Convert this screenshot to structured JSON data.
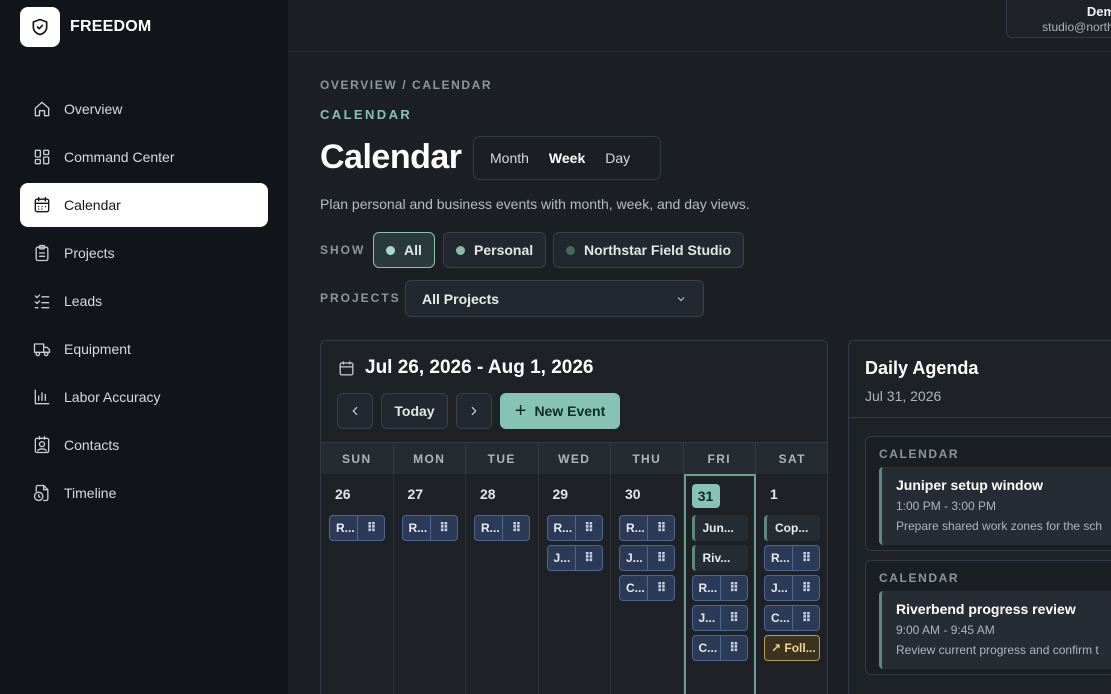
{
  "app": {
    "name": "FREEDOM"
  },
  "user": {
    "name": "Demo",
    "email": "studio@northst"
  },
  "sidebar": {
    "items": [
      {
        "label": "Overview",
        "icon": "home-icon"
      },
      {
        "label": "Command Center",
        "icon": "grid-icon"
      },
      {
        "label": "Calendar",
        "icon": "calendar-icon",
        "active": true
      },
      {
        "label": "Projects",
        "icon": "clipboard-icon"
      },
      {
        "label": "Leads",
        "icon": "checklist-icon"
      },
      {
        "label": "Equipment",
        "icon": "truck-icon"
      },
      {
        "label": "Labor Accuracy",
        "icon": "bar-chart-icon"
      },
      {
        "label": "Contacts",
        "icon": "contact-card-icon"
      },
      {
        "label": "Timeline",
        "icon": "clock-file-icon"
      }
    ]
  },
  "header": {
    "breadcrumb": "OVERVIEW / CALENDAR",
    "section": "CALENDAR",
    "title": "Calendar",
    "subtitle": "Plan personal and business events with month, week, and day views.",
    "views": [
      {
        "label": "Month",
        "active": false
      },
      {
        "label": "Week",
        "active": true
      },
      {
        "label": "Day",
        "active": false
      }
    ]
  },
  "filters": {
    "show_label": "SHOW",
    "chips": [
      {
        "label": "All",
        "active": true,
        "dot": "#a9d8cc"
      },
      {
        "label": "Personal",
        "active": false,
        "dot": "#8db8ad"
      },
      {
        "label": "Northstar Field Studio",
        "active": false,
        "dot": "#3f6b60"
      }
    ],
    "projects_label": "PROJECTS",
    "projects_value": "All Projects"
  },
  "calendar": {
    "range": "Jul 26, 2026 - Aug 1, 2026",
    "today_label": "Today",
    "new_event_label": "New Event",
    "weekdays": [
      "SUN",
      "MON",
      "TUE",
      "WED",
      "THU",
      "FRI",
      "SAT"
    ],
    "days": [
      {
        "num": "26",
        "events": [
          {
            "type": "chip",
            "text": "R..."
          }
        ]
      },
      {
        "num": "27",
        "events": [
          {
            "type": "chip",
            "text": "R..."
          }
        ]
      },
      {
        "num": "28",
        "events": [
          {
            "type": "chip",
            "text": "R..."
          }
        ]
      },
      {
        "num": "29",
        "events": [
          {
            "type": "chip",
            "text": "R..."
          },
          {
            "type": "chip",
            "text": "J..."
          }
        ]
      },
      {
        "num": "30",
        "events": [
          {
            "type": "chip",
            "text": "R..."
          },
          {
            "type": "chip",
            "text": "J..."
          },
          {
            "type": "chip",
            "text": "C..."
          }
        ]
      },
      {
        "num": "31",
        "today": true,
        "events": [
          {
            "type": "item",
            "text": "Jun..."
          },
          {
            "type": "item",
            "text": "Riv..."
          },
          {
            "type": "chip",
            "text": "R..."
          },
          {
            "type": "chip",
            "text": "J..."
          },
          {
            "type": "chip",
            "text": "C..."
          }
        ]
      },
      {
        "num": "1",
        "events": [
          {
            "type": "item",
            "text": "Cop..."
          },
          {
            "type": "chip",
            "text": "R..."
          },
          {
            "type": "chip",
            "text": "J..."
          },
          {
            "type": "chip",
            "text": "C..."
          },
          {
            "type": "follow",
            "text": "↗ Foll..."
          }
        ]
      }
    ]
  },
  "agenda": {
    "title": "Daily Agenda",
    "date": "Jul 31, 2026",
    "items": [
      {
        "kind": "CALENDAR",
        "title": "Juniper setup window",
        "time": "1:00 PM - 3:00 PM",
        "desc": "Prepare shared work zones for the sch"
      },
      {
        "kind": "CALENDAR",
        "title": "Riverbend progress review",
        "time": "9:00 AM - 9:45 AM",
        "desc": "Review current progress and confirm t"
      }
    ]
  },
  "colors": {
    "accent": "#87c3b3",
    "sidebar_bg": "#111519",
    "page_bg": "#1c1f24",
    "event_chip": "#2b3a57"
  }
}
